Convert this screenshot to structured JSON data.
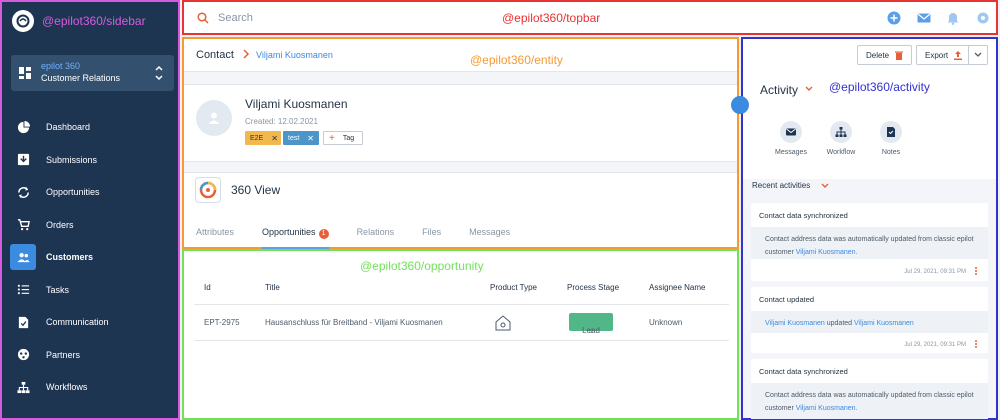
{
  "annotations": {
    "sidebar": "@epilot360/sidebar",
    "topbar": "@epilot360/topbar",
    "entity": "@epilot360/entity",
    "opportunity": "@epilot360/opportunity",
    "activity": "@epilot360/activity"
  },
  "sidebar": {
    "org_name": "epilot 360",
    "org_sub": "Customer Relations",
    "items": [
      {
        "label": "Dashboard",
        "icon": "pie-chart-icon"
      },
      {
        "label": "Submissions",
        "icon": "inbox-icon"
      },
      {
        "label": "Opportunities",
        "icon": "sync-icon"
      },
      {
        "label": "Orders",
        "icon": "cart-icon"
      },
      {
        "label": "Customers",
        "icon": "people-icon",
        "active": true
      },
      {
        "label": "Tasks",
        "icon": "list-icon"
      },
      {
        "label": "Communication",
        "icon": "document-check-icon"
      },
      {
        "label": "Partners",
        "icon": "partners-icon"
      },
      {
        "label": "Workflows",
        "icon": "workflow-icon"
      }
    ]
  },
  "topbar": {
    "search_placeholder": "Search"
  },
  "entity": {
    "breadcrumb_root": "Contact",
    "breadcrumb_current": "Viljami Kuosmanen",
    "name": "Viljami Kuosmanen",
    "created": "Created: 12.02.2021",
    "tags": [
      "E2E",
      "test"
    ],
    "add_tag_label": "Tag",
    "view_title": "360 View",
    "tabs": [
      {
        "label": "Attributes"
      },
      {
        "label": "Opportunities",
        "badge": "1",
        "active": true
      },
      {
        "label": "Relations"
      },
      {
        "label": "Files"
      },
      {
        "label": "Messages"
      }
    ]
  },
  "opportunity": {
    "columns": [
      "Id",
      "Title",
      "Product Type",
      "Process Stage",
      "Assignee Name"
    ],
    "rows": [
      {
        "id": "EPT-2975",
        "title": "Hausanschluss für Breitband - Viljami Kuosmanen",
        "product_type_icon": "house-network-icon",
        "stage": "Lead",
        "assignee": "Unknown"
      }
    ]
  },
  "activity": {
    "delete_label": "Delete",
    "export_label": "Export",
    "title": "Activity",
    "buttons": [
      {
        "label": "Messages",
        "icon": "mail-icon"
      },
      {
        "label": "Workflow",
        "icon": "workflow-icon"
      },
      {
        "label": "Notes",
        "icon": "note-icon"
      }
    ],
    "recent_label": "Recent activities",
    "cards": [
      {
        "title": "Contact data synchronized",
        "text": "Contact address data was automatically updated from classic epilot customer",
        "link": "Viljami Kuosmanen.",
        "ts": "Jul 29, 2021, 09:31 PM"
      },
      {
        "title": "Contact updated",
        "link1": "Viljami Kuosmanen",
        "text": "updated",
        "link2": "Viljami Kuosmanen",
        "ts": "Jul 29, 2021, 09:31 PM"
      },
      {
        "title": "Contact data synchronized",
        "text": "Contact address data was automatically updated from classic epilot customer",
        "link": "Viljami Kuosmanen."
      }
    ]
  },
  "colors": {
    "sidebar_bg": "#1e3552",
    "accent": "#3b8be0",
    "orange": "#e8603a",
    "lead_green": "#52b788"
  }
}
